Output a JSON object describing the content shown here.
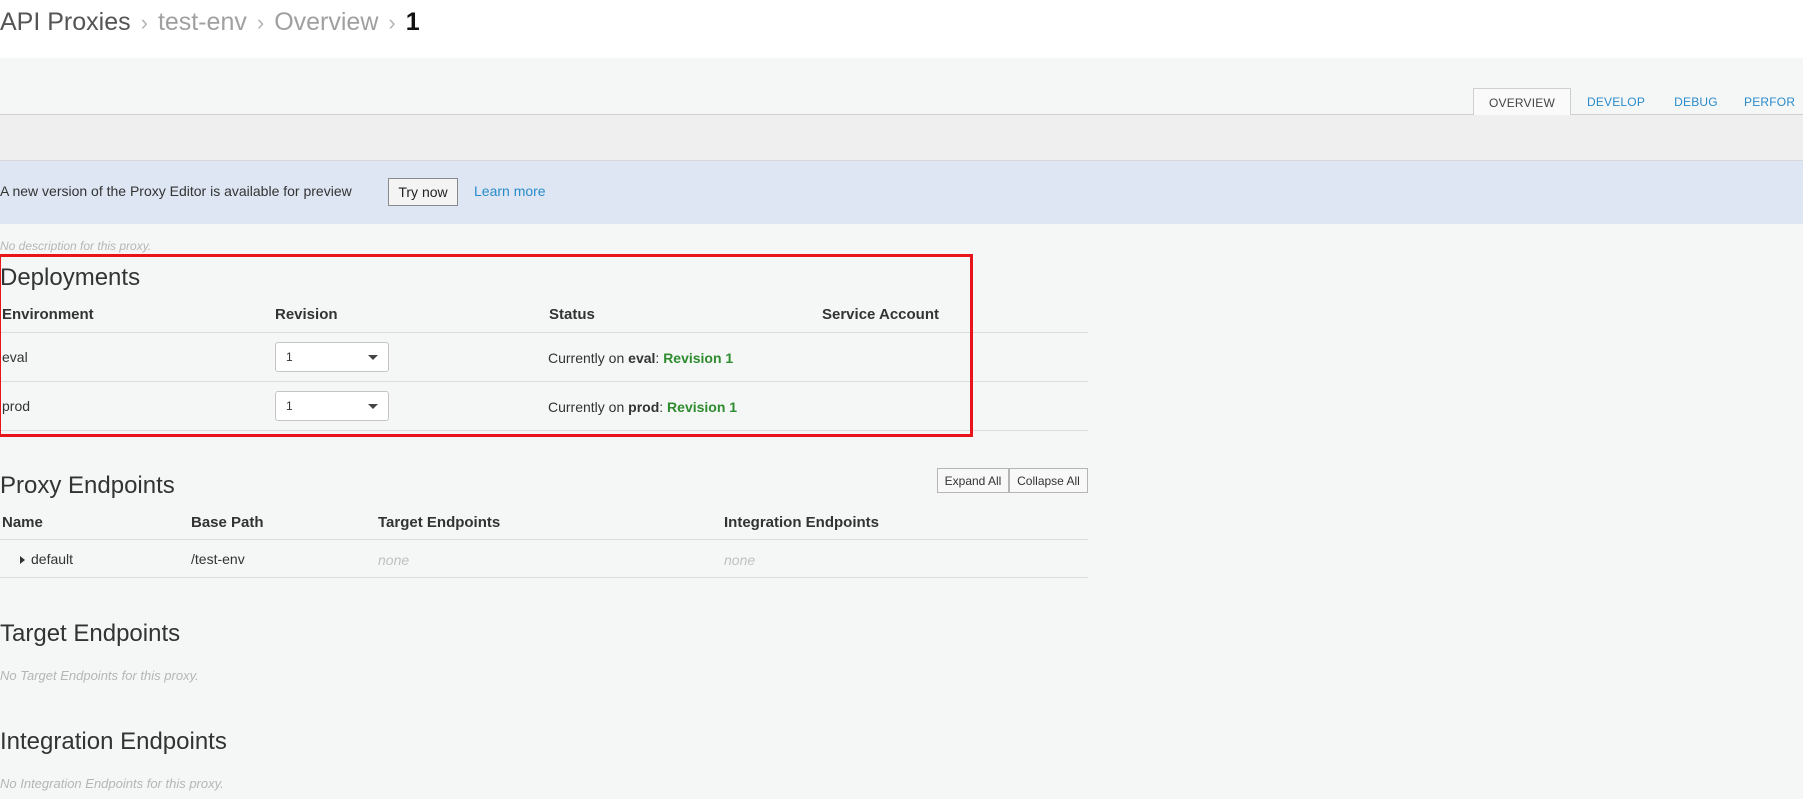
{
  "breadcrumb": [
    "API Proxies",
    "test-env",
    "Overview",
    "1"
  ],
  "tabs": [
    {
      "label": "OVERVIEW",
      "active": true
    },
    {
      "label": "DEVELOP",
      "active": false
    },
    {
      "label": "DEBUG",
      "active": false
    },
    {
      "label": "PERFOR",
      "active": false
    }
  ],
  "notice": {
    "text": "A new version of the Proxy Editor is available for preview",
    "try_label": "Try now",
    "learn_label": "Learn more"
  },
  "description": "No description for this proxy.",
  "deployments": {
    "title": "Deployments",
    "columns": [
      "Environment",
      "Revision",
      "Status",
      "Service Account"
    ],
    "rows": [
      {
        "env": "eval",
        "revision": "1",
        "status_prefix": "Currently on ",
        "status_env": "eval",
        "status_sep": ": ",
        "status_rev": "Revision 1"
      },
      {
        "env": "prod",
        "revision": "1",
        "status_prefix": "Currently on ",
        "status_env": "prod",
        "status_sep": ": ",
        "status_rev": "Revision 1"
      }
    ]
  },
  "proxy_endpoints": {
    "title": "Proxy Endpoints",
    "expand_label": "Expand All",
    "collapse_label": "Collapse All",
    "columns": [
      "Name",
      "Base Path",
      "Target Endpoints",
      "Integration Endpoints"
    ],
    "rows": [
      {
        "name": "default",
        "base_path": "/test-env",
        "target": "none",
        "integration": "none"
      }
    ]
  },
  "target_endpoints": {
    "title": "Target Endpoints",
    "empty": "No Target Endpoints for this proxy."
  },
  "integration_endpoints": {
    "title": "Integration Endpoints",
    "empty": "No Integration Endpoints for this proxy."
  },
  "colors": {
    "link": "#2a8bcb",
    "success": "#2e8b2e",
    "highlight": "#e8141a"
  }
}
